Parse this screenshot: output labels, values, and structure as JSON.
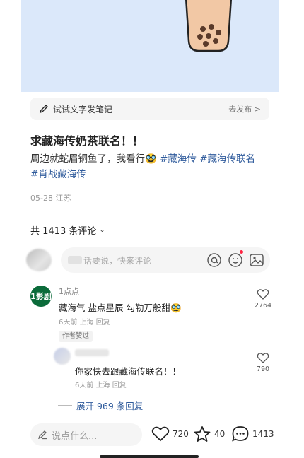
{
  "banner": {
    "label": "试试文字发笔记",
    "action": "去发布 >"
  },
  "note": {
    "title": "求藏海传奶茶联名！！",
    "body_text": "周边就蛇眉铜鱼了，我看行",
    "emoji": "🥸",
    "tags": [
      "#藏海传",
      "#藏海传联名",
      "#肖战藏海传"
    ],
    "date": "05-28",
    "location": "江苏"
  },
  "comments_header": {
    "label": "共 1413 条评论"
  },
  "comment_input": {
    "placeholder": "话要说，快来评论"
  },
  "comment1": {
    "avatar_text": "1影剧",
    "name": "1点点",
    "text": "藏海气 盐点星辰 勾勒万般甜",
    "emoji": "🥸",
    "time": "6天前",
    "location": "上海",
    "reply_label": "回复",
    "badge": "作者赞过",
    "likes": "2764"
  },
  "reply1": {
    "text": "你家快去跟藏海传联名！！",
    "time": "6天前",
    "location": "上海",
    "reply_label": "回复",
    "likes": "790"
  },
  "expand_label": "展开 969 条回复",
  "bottom_bar": {
    "placeholder": "说点什么...",
    "likes": "720",
    "favorites": "40",
    "comments": "1413"
  },
  "colors": {
    "tag_blue": "#2f5b9c",
    "hero_bg": "#dbe8fa",
    "notify_dot": "#ff2442"
  }
}
